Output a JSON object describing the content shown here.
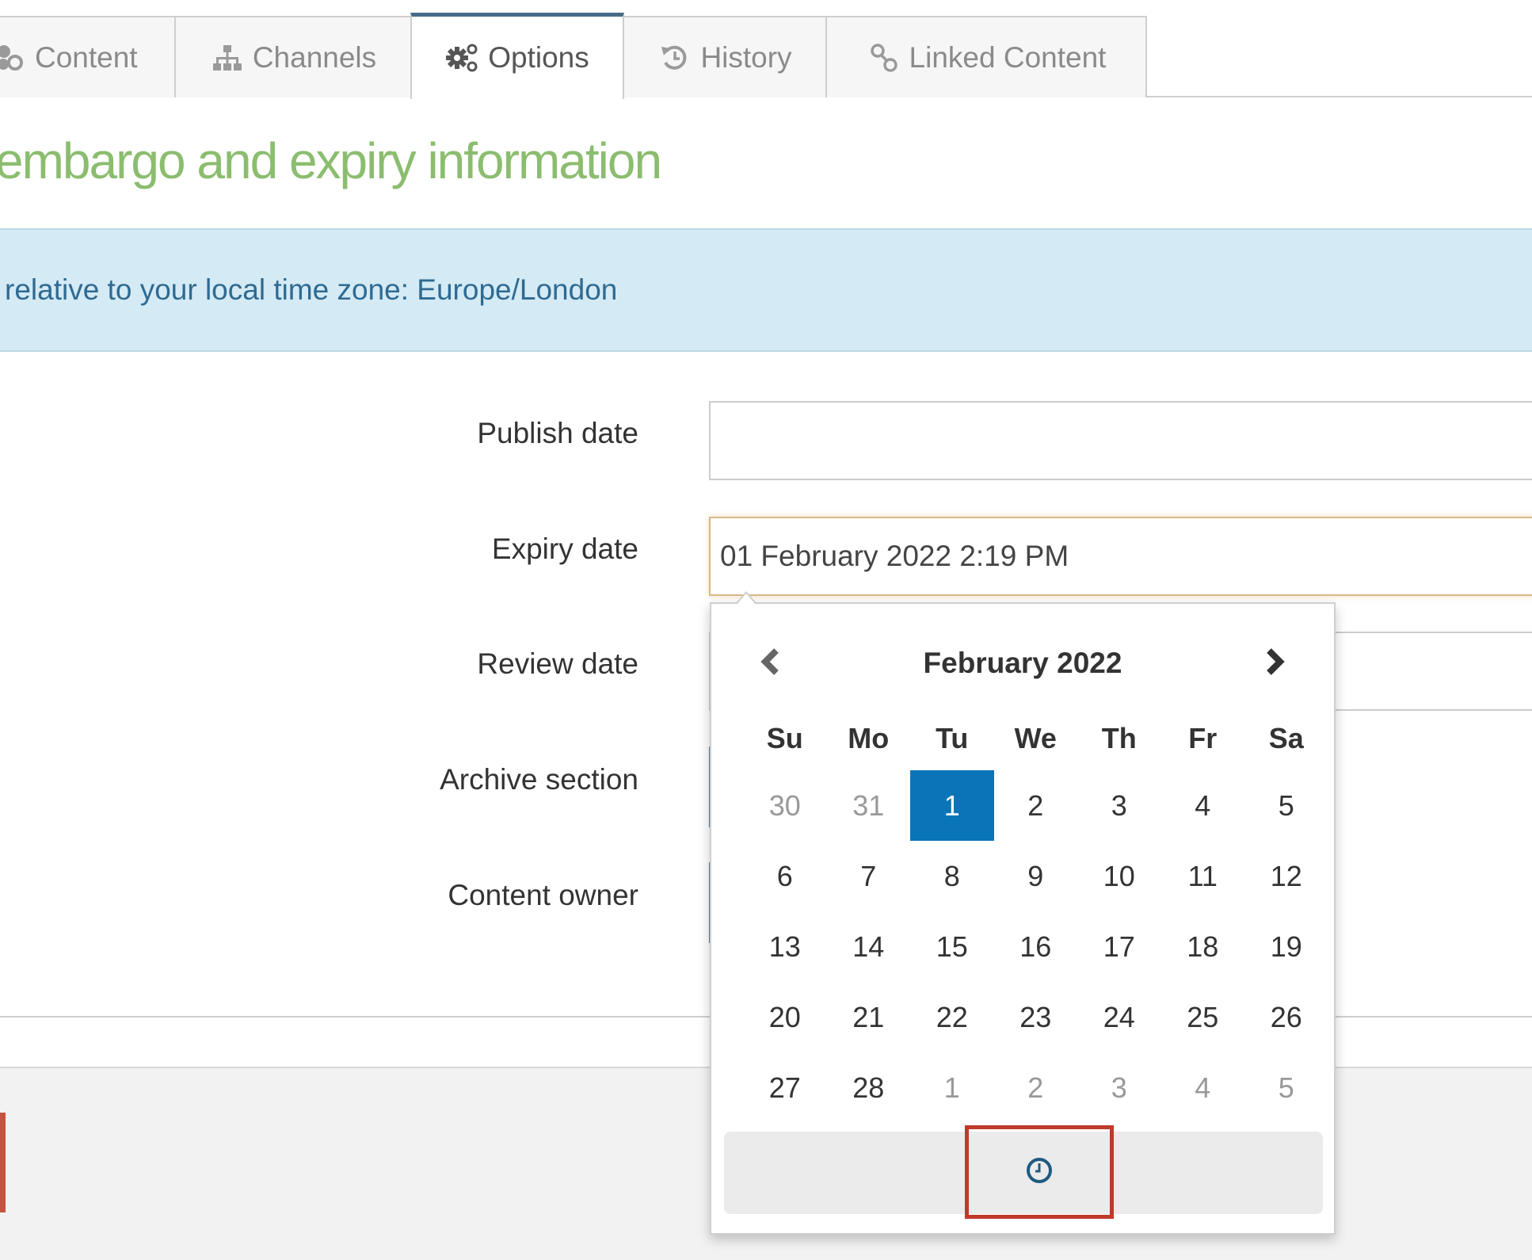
{
  "tabs": [
    {
      "id": "content",
      "label": "Content",
      "icon": "content-icon",
      "active": false
    },
    {
      "id": "channels",
      "label": "Channels",
      "icon": "sitemap-icon",
      "active": false
    },
    {
      "id": "options",
      "label": "Options",
      "icon": "gears-icon",
      "active": true
    },
    {
      "id": "history",
      "label": "History",
      "icon": "history-icon",
      "active": false
    },
    {
      "id": "linked",
      "label": "Linked Content",
      "icon": "link-icon",
      "active": false
    }
  ],
  "section": {
    "title": "embargo and expiry information"
  },
  "info": {
    "text": "relative to your local time zone: Europe/London"
  },
  "form": {
    "publish_date": {
      "label": "Publish date",
      "value": ""
    },
    "expiry_date": {
      "label": "Expiry date",
      "value": "01 February 2022 2:19 PM"
    },
    "review_date": {
      "label": "Review date",
      "value": ""
    },
    "archive_section": {
      "label": "Archive section"
    },
    "content_owner": {
      "label": "Content owner"
    }
  },
  "datepicker": {
    "title": "February 2022",
    "prev_icon": "chevron-left-icon",
    "next_icon": "chevron-right-icon",
    "weekdays": [
      "Su",
      "Mo",
      "Tu",
      "We",
      "Th",
      "Fr",
      "Sa"
    ],
    "weeks": [
      [
        {
          "d": "30",
          "m": true
        },
        {
          "d": "31",
          "m": true
        },
        {
          "d": "1",
          "sel": true
        },
        {
          "d": "2"
        },
        {
          "d": "3"
        },
        {
          "d": "4"
        },
        {
          "d": "5"
        }
      ],
      [
        {
          "d": "6"
        },
        {
          "d": "7"
        },
        {
          "d": "8"
        },
        {
          "d": "9"
        },
        {
          "d": "10"
        },
        {
          "d": "11"
        },
        {
          "d": "12"
        }
      ],
      [
        {
          "d": "13"
        },
        {
          "d": "14"
        },
        {
          "d": "15"
        },
        {
          "d": "16"
        },
        {
          "d": "17"
        },
        {
          "d": "18"
        },
        {
          "d": "19"
        }
      ],
      [
        {
          "d": "20"
        },
        {
          "d": "21"
        },
        {
          "d": "22"
        },
        {
          "d": "23"
        },
        {
          "d": "24"
        },
        {
          "d": "25"
        },
        {
          "d": "26"
        }
      ],
      [
        {
          "d": "27"
        },
        {
          "d": "28"
        },
        {
          "d": "1",
          "m": true
        },
        {
          "d": "2",
          "m": true
        },
        {
          "d": "3",
          "m": true
        },
        {
          "d": "4",
          "m": true
        },
        {
          "d": "5",
          "m": true
        }
      ]
    ],
    "selected_date": "1",
    "time_toggle_icon": "clock-icon"
  },
  "colors": {
    "accent_tab": "#486c88",
    "heading_green": "#8bbd6f",
    "info_bg": "#d4eaf5",
    "info_text": "#2f6a91",
    "selected_day": "#0a74b8",
    "highlight_red": "#c0392b"
  }
}
